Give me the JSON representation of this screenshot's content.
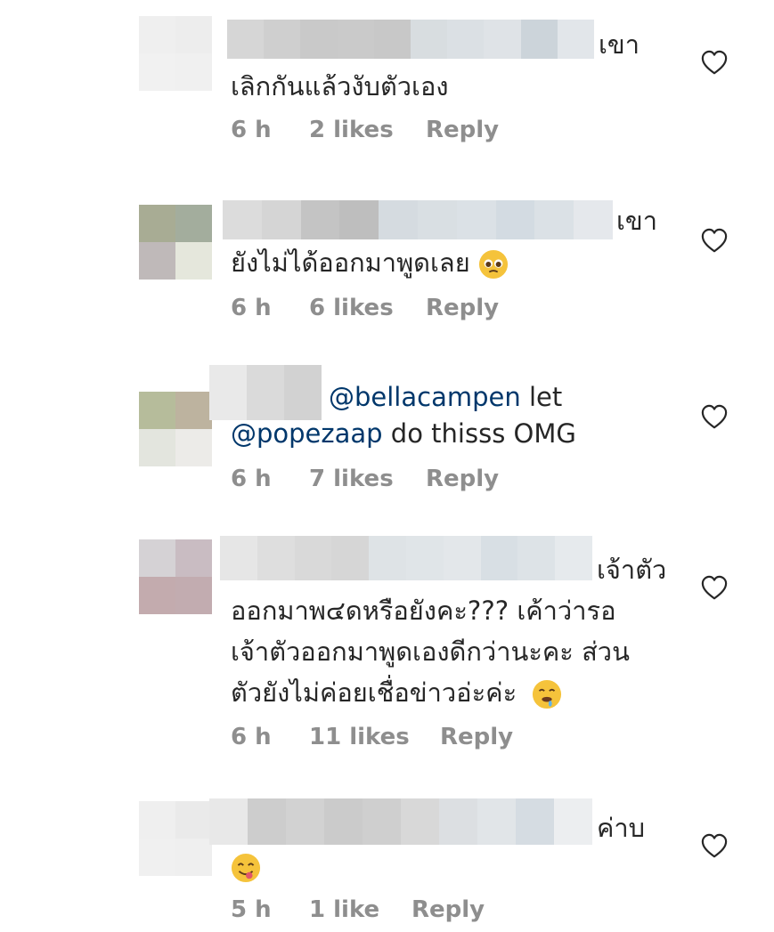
{
  "comments": [
    {
      "text_lines": [
        "เขา",
        "เลิกกันแล้วงับตัวเอง"
      ],
      "time": "6 h",
      "likes": "2 likes",
      "reply": "Reply"
    },
    {
      "text_lines": [
        "เขา",
        "ยังไม่ได้ออกมาพูดเลย"
      ],
      "emoji": "pleading-face-icon",
      "time": "6 h",
      "likes": "6 likes",
      "reply": "Reply"
    },
    {
      "mention1": "@bellacampen",
      "after_mention1": " let",
      "mention2": "@popezaap",
      "after_mention2": " do thisss OMG",
      "time": "6 h",
      "likes": "7 likes",
      "reply": "Reply"
    },
    {
      "text_lines": [
        "เจ้าตัว",
        "ออกมาพ๔ดหรือยังคะ??? เค้าว่ารอ",
        "เจ้าตัวออกมาพูดเองดีกว่านะคะ ส่วน",
        "ตัวยังไม่ค่อยเชื่อข่าวอ่ะค่ะ"
      ],
      "emoji": "drooling-face-icon",
      "time": "6 h",
      "likes": "11 likes",
      "reply": "Reply"
    },
    {
      "text_lines": [
        "ค่าบ"
      ],
      "emoji": "yum-face-icon",
      "time": "5 h",
      "likes": "1 like",
      "reply": "Reply"
    }
  ],
  "colors": {
    "text": "#262626",
    "meta": "#8e8e8e",
    "mention": "#00376b",
    "background": "#ffffff"
  }
}
